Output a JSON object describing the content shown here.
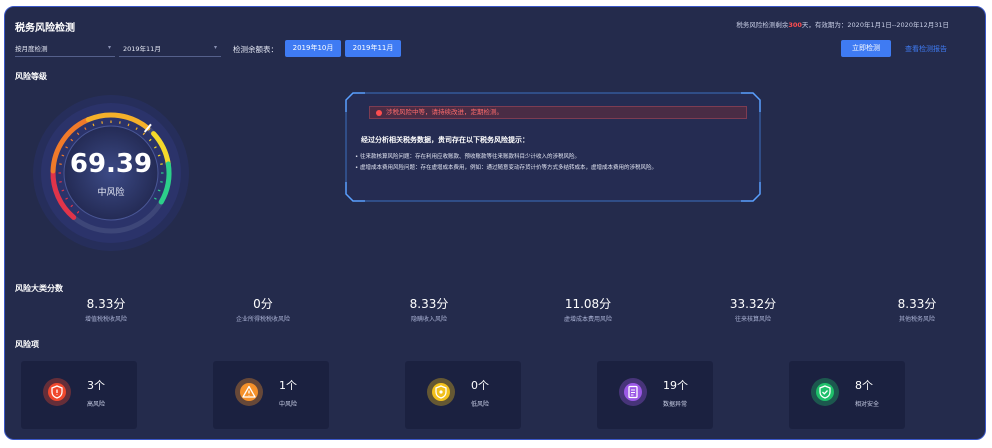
{
  "title": "税务风险检测",
  "top_note": {
    "prefix": "税务风险检测剩余",
    "days": "300",
    "suffix": "天，有效期为：2020年1月1日--2020年12月31日"
  },
  "filters": {
    "period_type": "按月度检测",
    "month": "2019年11月"
  },
  "remaining_label": "检测余额表：",
  "remaining_buttons": [
    "2019年10月",
    "2019年11月"
  ],
  "actions": {
    "check_now": "立即检测",
    "view_report": "查看检测报告"
  },
  "risk_level": {
    "section": "风险等级",
    "score": "69.39",
    "label": "中风险",
    "score_fraction": 0.69
  },
  "risk_panel": {
    "warning": "涉税风险中等，请持续改进，定期检测。",
    "heading": "经过分析相关税务数据，贵司存在以下税务风险提示：",
    "items": [
      "往来款核算风险问题：存在利用应收账款、预收账款等往来账款科目少计收入的涉税风险。",
      "虚增成本费用风险问题：存在虚增成本费用，例如：通过随意变动存货计价等方式多结转成本，虚增成本费用的涉税风险。"
    ]
  },
  "category": {
    "section": "风险大类分数",
    "items": [
      {
        "value": "8.33分",
        "name": "增值税税收风险"
      },
      {
        "value": "0分",
        "name": "企业所得税税收风险"
      },
      {
        "value": "8.33分",
        "name": "隐瞒收入风险"
      },
      {
        "value": "11.08分",
        "name": "虚增成本费用风险"
      },
      {
        "value": "33.32分",
        "name": "往来核算风险"
      },
      {
        "value": "8.33分",
        "name": "其他税务风险"
      }
    ]
  },
  "items_section": {
    "section": "风险项",
    "cards": [
      {
        "count": "3个",
        "label": "高风险",
        "icon": "shield-alert-icon",
        "color": "#f0482d"
      },
      {
        "count": "1个",
        "label": "中风险",
        "icon": "warning-triangle-icon",
        "color": "#f5912a"
      },
      {
        "count": "0个",
        "label": "低风险",
        "icon": "shield-icon",
        "color": "#f2c11c"
      },
      {
        "count": "19个",
        "label": "数据异常",
        "icon": "document-icon",
        "color": "#9b59e6"
      },
      {
        "count": "8个",
        "label": "相对安全",
        "icon": "shield-check-icon",
        "color": "#1fbf6a"
      }
    ]
  }
}
